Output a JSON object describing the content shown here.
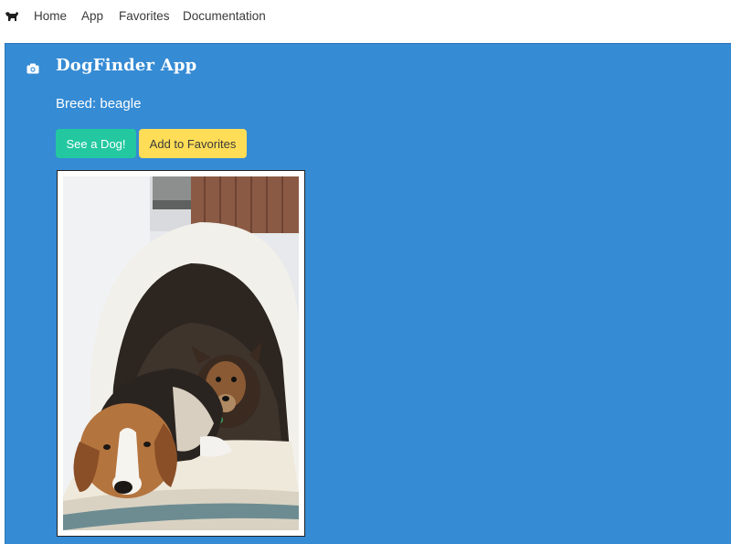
{
  "navbar": {
    "logo_icon": "dog-icon",
    "links": [
      "Home",
      "App",
      "Favorites",
      "Documentation"
    ]
  },
  "header": {
    "icon": "camera-icon",
    "title": "DogFinder App"
  },
  "breed": {
    "text": "Breed: beagle"
  },
  "buttons": {
    "see_dog": "See a Dog!",
    "add_favorites": "Add to Favorites"
  },
  "colors": {
    "panel_bg": "#358bd4",
    "see_button": "#23c8a0",
    "favorites_button": "#ffdd57"
  },
  "photo": {
    "icon": "dog-photo"
  }
}
